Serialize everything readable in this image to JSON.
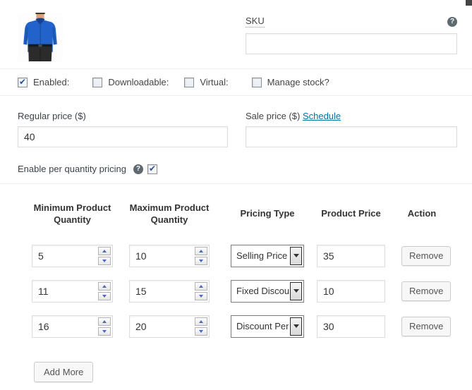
{
  "window": {
    "corner_fragment_color": "#454545"
  },
  "product_image": {
    "name": "blue-shirt-thumbnail",
    "shirt_color": "#2163cb",
    "collar_color": "#173f8f",
    "pants_color": "#2b2b2b",
    "skin_color": "#d8a27d"
  },
  "sku": {
    "label": "SKU",
    "value": "",
    "help_icon": "?"
  },
  "options": {
    "items": [
      {
        "label": "Enabled:",
        "checked": true
      },
      {
        "label": "Downloadable:",
        "checked": false
      },
      {
        "label": "Virtual:",
        "checked": false
      },
      {
        "label": "Manage stock?",
        "checked": false
      }
    ]
  },
  "pricing": {
    "regular": {
      "label": "Regular price ($)",
      "value": "40"
    },
    "sale": {
      "label": "Sale price ($)",
      "link": "Schedule",
      "value": ""
    }
  },
  "per_quantity": {
    "label": "Enable per quantity pricing",
    "help_icon": "?",
    "checked": true
  },
  "quantity_table": {
    "headers": [
      "Minimum Product Quantity",
      "Maximum Product Quantity",
      "Pricing Type",
      "Product Price",
      "Action"
    ],
    "rows": [
      {
        "min": "5",
        "max": "10",
        "pricing_type": "Selling Price",
        "price": "35",
        "action": "Remove"
      },
      {
        "min": "11",
        "max": "15",
        "pricing_type": "Fixed Discou",
        "price": "10",
        "action": "Remove"
      },
      {
        "min": "16",
        "max": "20",
        "pricing_type": "Discount Per",
        "price": "30",
        "action": "Remove"
      }
    ],
    "add_more_label": "Add More"
  },
  "colors": {
    "link": "#0074a2",
    "check": "#2b4f9e",
    "divider": "#eeeeee",
    "help_bg": "#5e6a71"
  }
}
